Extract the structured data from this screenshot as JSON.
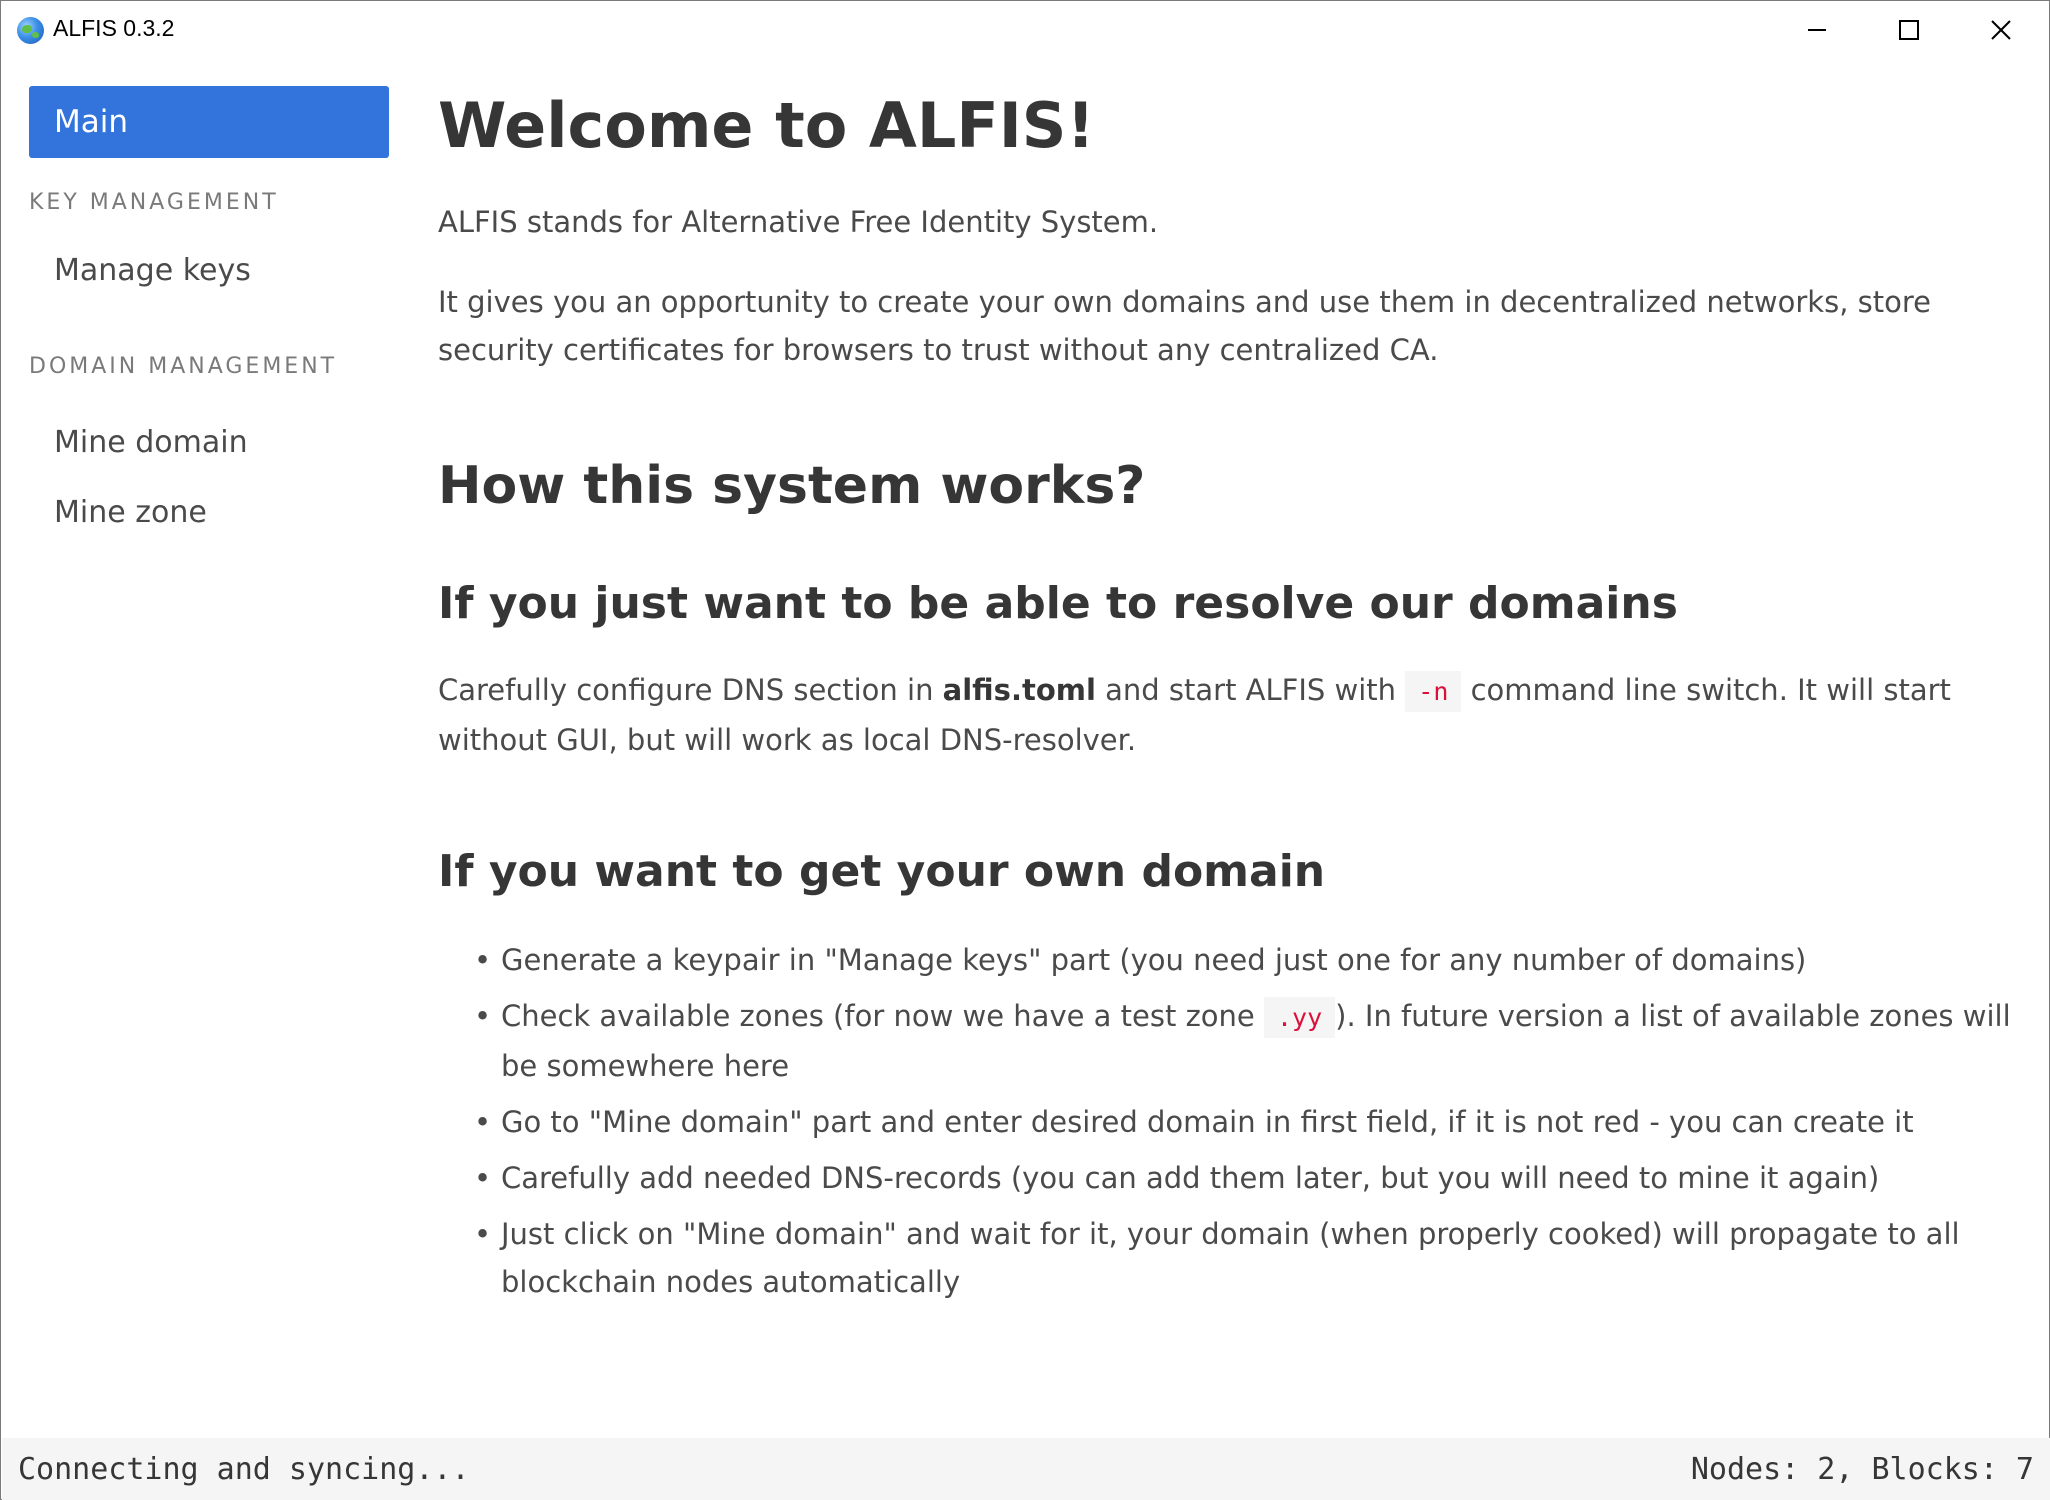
{
  "window": {
    "title": "ALFIS 0.3.2"
  },
  "sidebar": {
    "main_label": "Main",
    "key_management_label": "KEY MANAGEMENT",
    "manage_keys_label": "Manage keys",
    "domain_management_label": "DOMAIN MANAGEMENT",
    "mine_domain_label": "Mine domain",
    "mine_zone_label": "Mine zone"
  },
  "content": {
    "title": "Welcome to ALFIS!",
    "intro": "ALFIS stands for Alternative Free Identity System.",
    "description": "It gives you an opportunity to create your own domains and use them in decentralized networks, store security certificates for browsers to trust without any centralized CA.",
    "how_heading": "How this system works?",
    "resolve_heading": "If you just want to be able to resolve our domains",
    "resolve_text_1": "Carefully configure DNS section in ",
    "resolve_config_file": "alfis.toml",
    "resolve_text_2": " and start ALFIS with ",
    "resolve_flag": "-n",
    "resolve_text_3": " command line switch. It will start without GUI, but will work as local DNS-resolver.",
    "own_heading": "If you want to get your own domain",
    "steps": {
      "step1": "Generate a keypair in \"Manage keys\" part (you need just one for any number of domains)",
      "step2_a": "Check available zones (for now we have a test zone ",
      "step2_zone": ".yy",
      "step2_b": "). In future version a list of available zones will be somewhere here",
      "step3": "Go to \"Mine domain\" part and enter desired domain in first field, if it is not red - you can create it",
      "step4": "Carefully add needed DNS-records (you can add them later, but you will need to mine it again)",
      "step5": "Just click on \"Mine domain\" and wait for it, your domain (when properly cooked) will propagate to all blockchain nodes automatically"
    }
  },
  "status": {
    "left": "Connecting and syncing...",
    "right": "Nodes: 2, Blocks: 7"
  },
  "colors": {
    "accent": "#3273dc",
    "code_text": "#da1039",
    "code_bg": "#f5f5f5",
    "statusbar_bg": "#f5f5f5"
  },
  "icons": {
    "app": "globe-icon",
    "minimize": "minimize-icon",
    "maximize": "maximize-icon",
    "close": "close-icon"
  }
}
